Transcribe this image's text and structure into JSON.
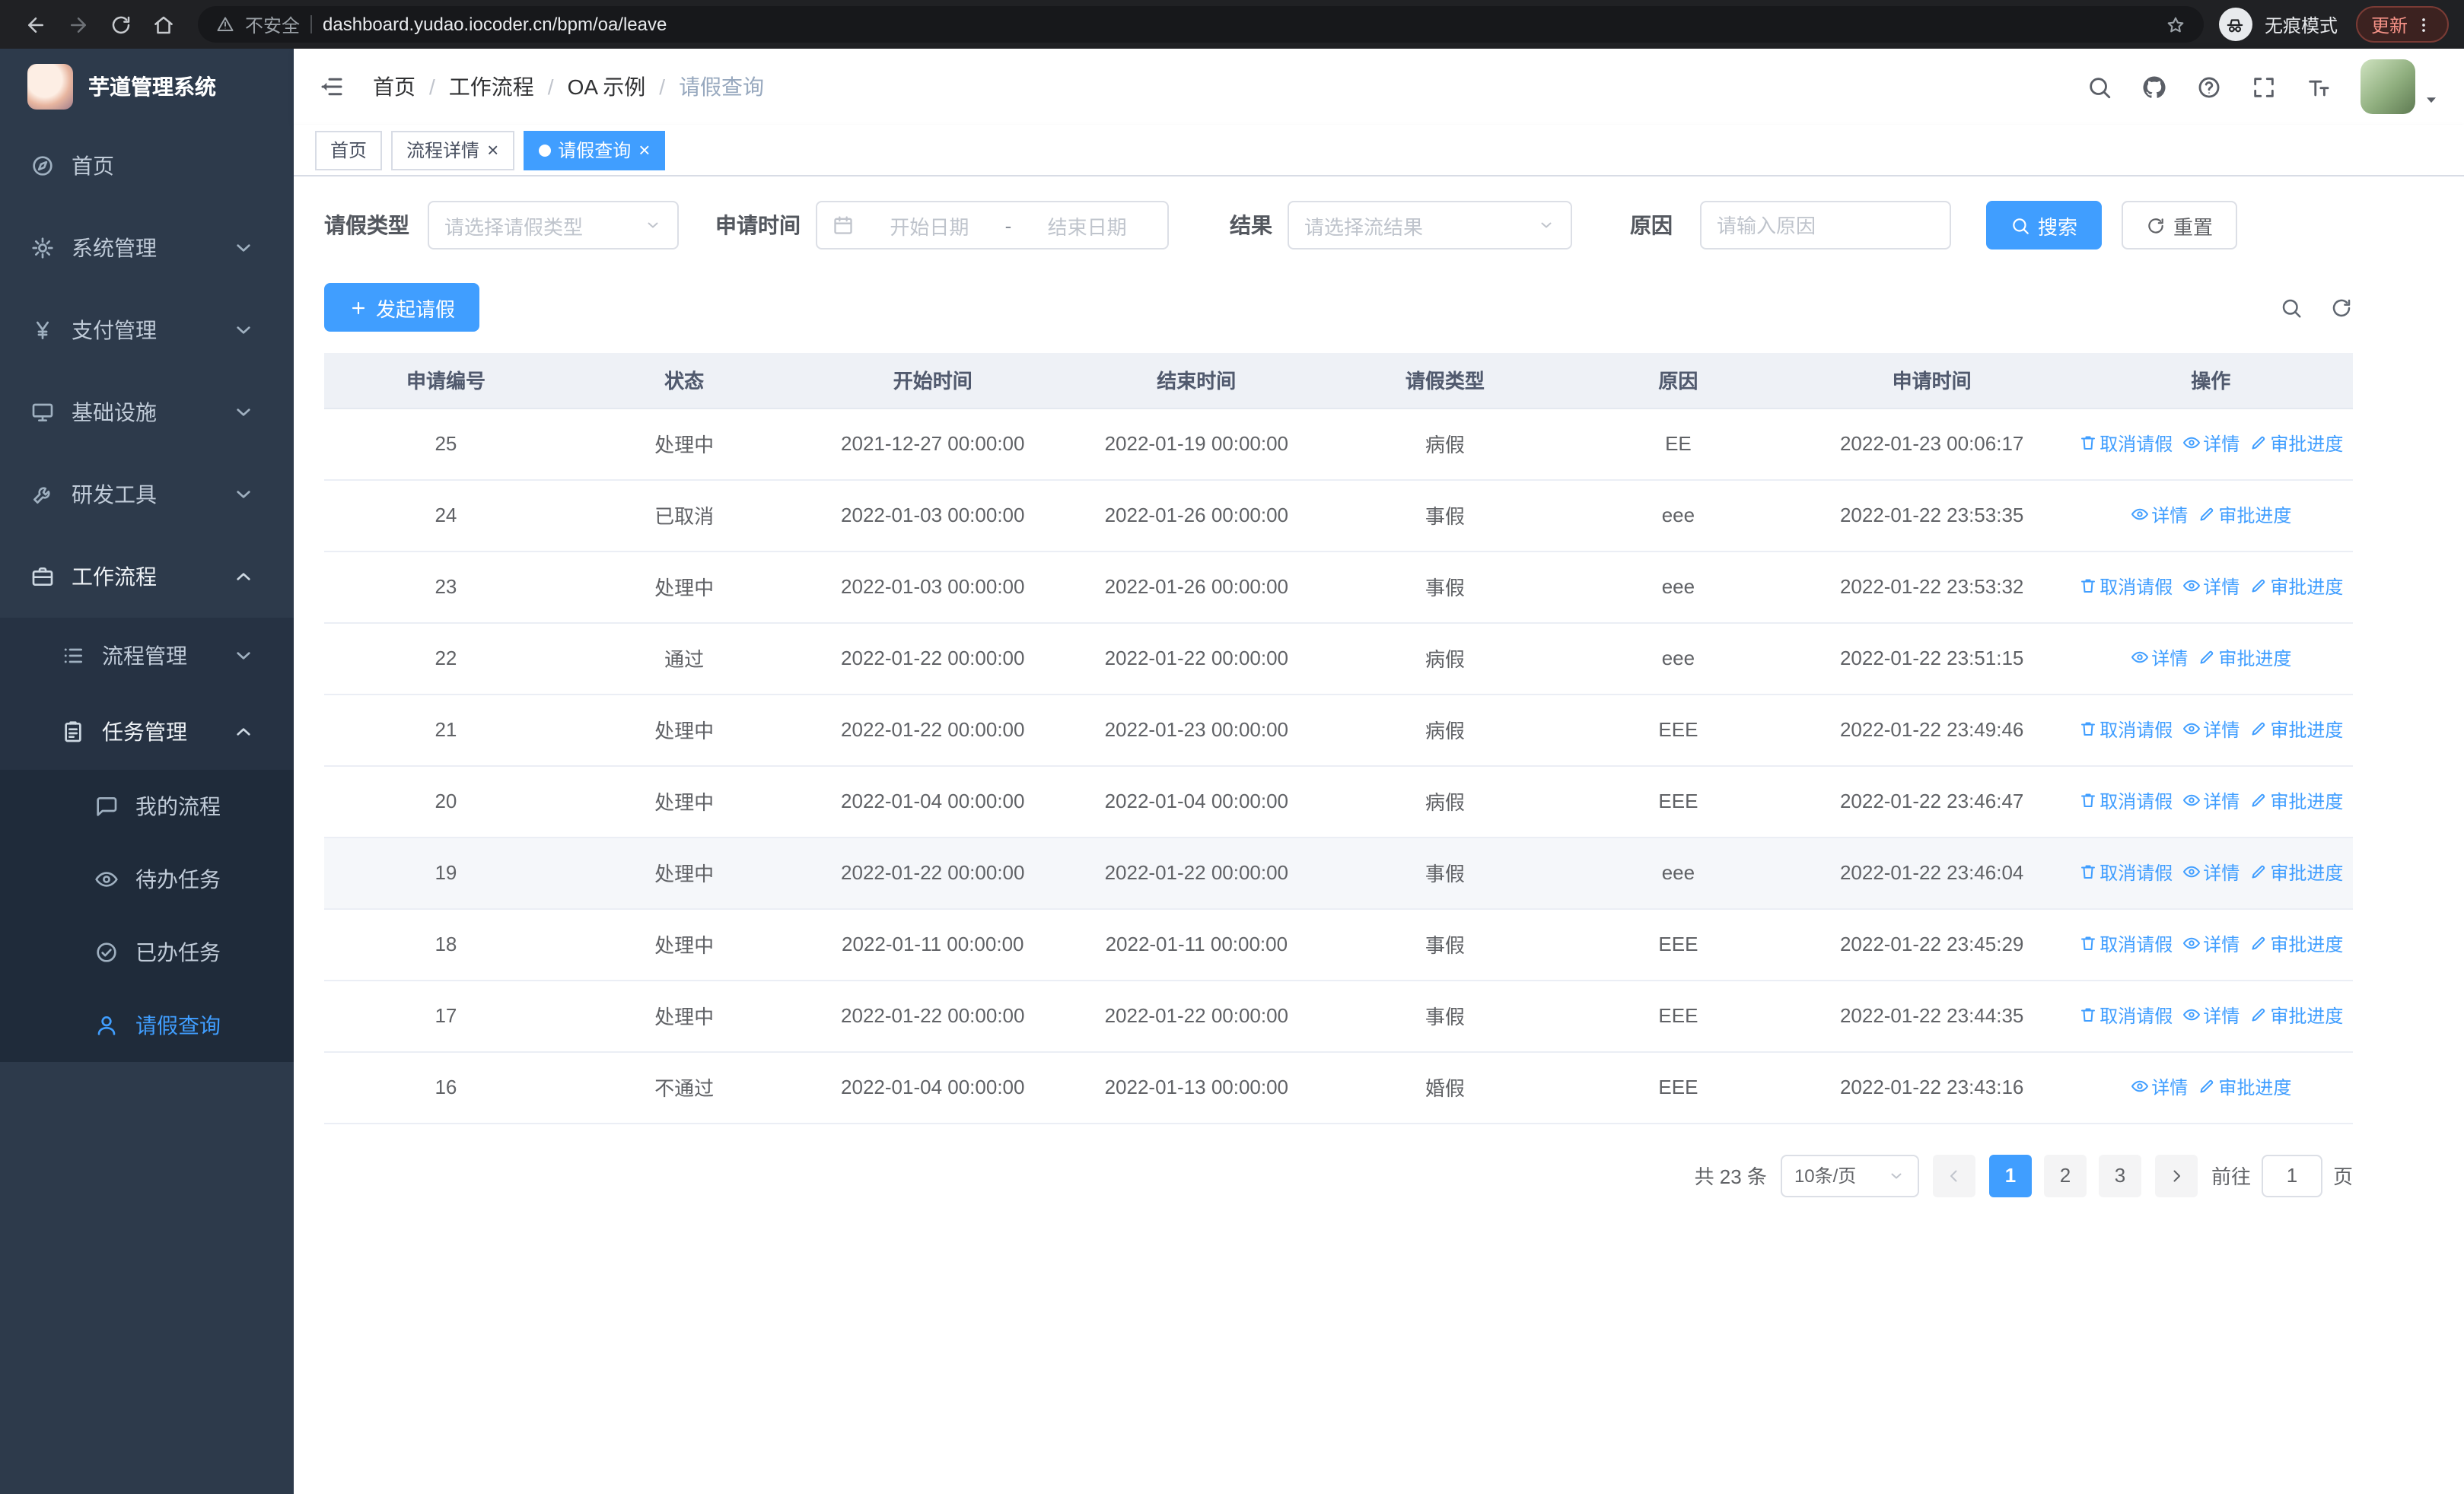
{
  "browser": {
    "security_label": "不安全",
    "url": "dashboard.yudao.iocoder.cn/bpm/oa/leave",
    "incognito_label": "无痕模式",
    "update_label": "更新"
  },
  "app": {
    "title": "芋道管理系统"
  },
  "breadcrumb": [
    "首页",
    "工作流程",
    "OA 示例",
    "请假查询"
  ],
  "tabs": [
    {
      "key": "home",
      "label": "首页",
      "closable": false,
      "active": false
    },
    {
      "key": "process-detail",
      "label": "流程详情",
      "closable": true,
      "active": false
    },
    {
      "key": "leave-query",
      "label": "请假查询",
      "closable": true,
      "active": true
    }
  ],
  "sidebar": {
    "items": [
      {
        "key": "home",
        "icon": "dashboard-icon",
        "label": "首页"
      },
      {
        "key": "system-management",
        "icon": "gear-icon",
        "label": "系统管理",
        "expandable": true
      },
      {
        "key": "payment-management",
        "icon": "yen-icon",
        "label": "支付管理",
        "expandable": true
      },
      {
        "key": "infrastructure",
        "icon": "infra-icon",
        "label": "基础设施",
        "expandable": true
      },
      {
        "key": "dev-tools",
        "icon": "tools-icon",
        "label": "研发工具",
        "expandable": true
      },
      {
        "key": "workflow",
        "icon": "workflow-icon",
        "label": "工作流程",
        "expandable": true,
        "expanded": true,
        "children": [
          {
            "key": "process-management",
            "icon": "process-icon",
            "label": "流程管理",
            "expandable": true
          },
          {
            "key": "task-management",
            "icon": "task-icon",
            "label": "任务管理",
            "expandable": true,
            "expanded": true,
            "children": [
              {
                "key": "my-process",
                "icon": "chat-icon",
                "label": "我的流程"
              },
              {
                "key": "todo-tasks",
                "icon": "eye-icon",
                "label": "待办任务"
              },
              {
                "key": "done-tasks",
                "icon": "check-icon",
                "label": "已办任务"
              },
              {
                "key": "leave-query",
                "icon": "user-icon",
                "label": "请假查询",
                "active": true
              }
            ]
          }
        ]
      }
    ]
  },
  "filters": {
    "leave_type_label": "请假类型",
    "leave_type_placeholder": "请选择请假类型",
    "apply_time_label": "申请时间",
    "start_date_placeholder": "开始日期",
    "range_separator": "-",
    "end_date_placeholder": "结束日期",
    "result_label": "结果",
    "result_placeholder": "请选择流结果",
    "reason_label": "原因",
    "reason_placeholder": "请输入原因",
    "search_label": "搜索",
    "reset_label": "重置"
  },
  "toolbar": {
    "create_label": "发起请假"
  },
  "table": {
    "columns": [
      "申请编号",
      "状态",
      "开始时间",
      "结束时间",
      "请假类型",
      "原因",
      "申请时间",
      "操作"
    ],
    "action_icons": {
      "取消请假": "trash-icon",
      "详情": "eye-icon",
      "审批进度": "pen-icon"
    },
    "action_keys": {
      "取消请假": "cancel-leave",
      "详情": "detail",
      "审批进度": "approval-progress"
    },
    "rows": [
      {
        "id": "25",
        "status": "处理中",
        "start": "2021-12-27 00:00:00",
        "end": "2022-01-19 00:00:00",
        "type": "病假",
        "reason": "EE",
        "applied": "2022-01-23 00:06:17",
        "actions": [
          "取消请假",
          "详情",
          "审批进度"
        ]
      },
      {
        "id": "24",
        "status": "已取消",
        "start": "2022-01-03 00:00:00",
        "end": "2022-01-26 00:00:00",
        "type": "事假",
        "reason": "eee",
        "applied": "2022-01-22 23:53:35",
        "actions": [
          "详情",
          "审批进度"
        ]
      },
      {
        "id": "23",
        "status": "处理中",
        "start": "2022-01-03 00:00:00",
        "end": "2022-01-26 00:00:00",
        "type": "事假",
        "reason": "eee",
        "applied": "2022-01-22 23:53:32",
        "actions": [
          "取消请假",
          "详情",
          "审批进度"
        ]
      },
      {
        "id": "22",
        "status": "通过",
        "start": "2022-01-22 00:00:00",
        "end": "2022-01-22 00:00:00",
        "type": "病假",
        "reason": "eee",
        "applied": "2022-01-22 23:51:15",
        "actions": [
          "详情",
          "审批进度"
        ]
      },
      {
        "id": "21",
        "status": "处理中",
        "start": "2022-01-22 00:00:00",
        "end": "2022-01-23 00:00:00",
        "type": "病假",
        "reason": "EEE",
        "applied": "2022-01-22 23:49:46",
        "actions": [
          "取消请假",
          "详情",
          "审批进度"
        ]
      },
      {
        "id": "20",
        "status": "处理中",
        "start": "2022-01-04 00:00:00",
        "end": "2022-01-04 00:00:00",
        "type": "病假",
        "reason": "EEE",
        "applied": "2022-01-22 23:46:47",
        "actions": [
          "取消请假",
          "详情",
          "审批进度"
        ]
      },
      {
        "id": "19",
        "status": "处理中",
        "start": "2022-01-22 00:00:00",
        "end": "2022-01-22 00:00:00",
        "type": "事假",
        "reason": "eee",
        "applied": "2022-01-22 23:46:04",
        "actions": [
          "取消请假",
          "详情",
          "审批进度"
        ],
        "highlighted": true
      },
      {
        "id": "18",
        "status": "处理中",
        "start": "2022-01-11 00:00:00",
        "end": "2022-01-11 00:00:00",
        "type": "事假",
        "reason": "EEE",
        "applied": "2022-01-22 23:45:29",
        "actions": [
          "取消请假",
          "详情",
          "审批进度"
        ]
      },
      {
        "id": "17",
        "status": "处理中",
        "start": "2022-01-22 00:00:00",
        "end": "2022-01-22 00:00:00",
        "type": "事假",
        "reason": "EEE",
        "applied": "2022-01-22 23:44:35",
        "actions": [
          "取消请假",
          "详情",
          "审批进度"
        ]
      },
      {
        "id": "16",
        "status": "不通过",
        "start": "2022-01-04 00:00:00",
        "end": "2022-01-13 00:00:00",
        "type": "婚假",
        "reason": "EEE",
        "applied": "2022-01-22 23:43:16",
        "actions": [
          "详情",
          "审批进度"
        ]
      }
    ]
  },
  "pagination": {
    "total_text": "共 23 条",
    "page_size": "10条/页",
    "pages": [
      "1",
      "2",
      "3"
    ],
    "active_page": "1",
    "goto_label": "前往",
    "goto_value": "1",
    "page_suffix": "页"
  },
  "colors": {
    "accent": "#409eff",
    "sidebar_bg": "#2d3a4b"
  }
}
